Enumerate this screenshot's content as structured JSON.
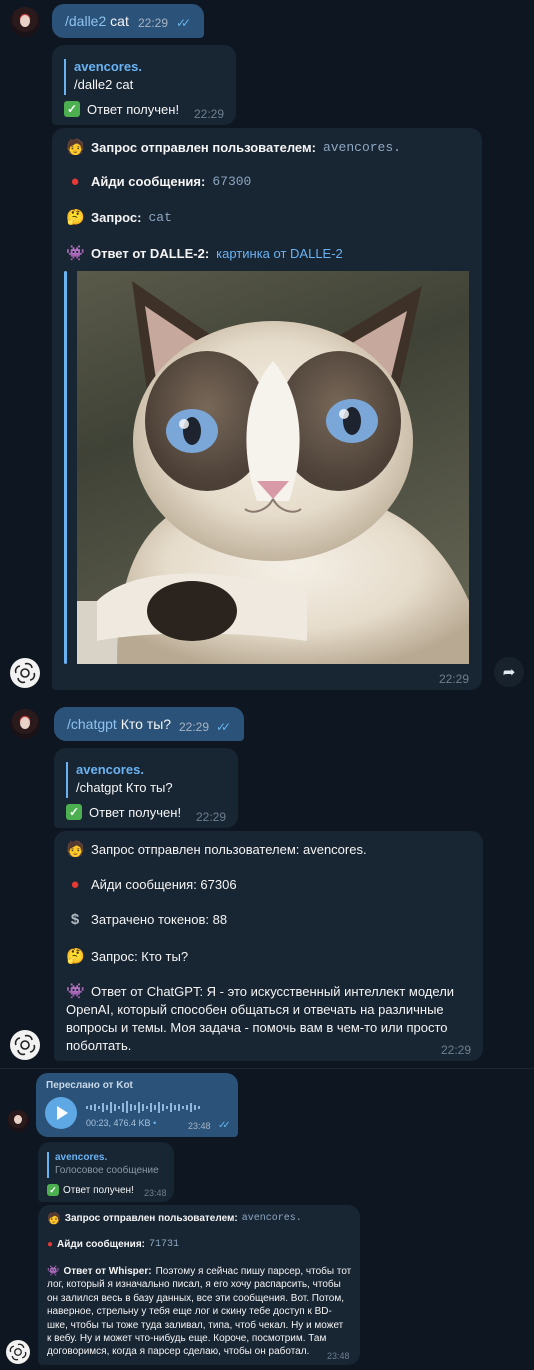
{
  "colors": {
    "bg": "#0e1621",
    "outgoing": "#2b5278",
    "incoming": "#182533",
    "accent": "#6ab3f3"
  },
  "msg1": {
    "command": "/dalle2",
    "text": "cat",
    "time": "22:29"
  },
  "reply1": {
    "name": "avencores.",
    "quote": "/dalle2 cat",
    "status": "Ответ получен!",
    "time": "22:29"
  },
  "bot1": {
    "sent_label": "Запрос отправлен пользователем:",
    "user": "avencores.",
    "id_label": "Айди сообщения:",
    "id_value": "67300",
    "query_label": "Запрос:",
    "query_value": "cat",
    "answer_label": "Ответ от DALLE-2:",
    "answer_link": "картинка от DALLE-2",
    "time": "22:29"
  },
  "msg2": {
    "command": "/chatgpt",
    "text": "Кто ты?",
    "time": "22:29"
  },
  "reply2": {
    "name": "avencores.",
    "quote": "/chatgpt Кто ты?",
    "status": "Ответ получен!",
    "time": "22:29"
  },
  "bot2": {
    "sent_line": "Запрос отправлен пользователем: avencores.",
    "id_line": "Айди сообщения: 67306",
    "tokens_line": "Затрачено токенов: 88",
    "query_line": "Запрос: Кто ты?",
    "answer_lines": [
      "Ответ от ChatGPT: Я - это искусственный интеллект модели",
      "OpenAI, который способен общаться и отвечать на различные",
      "вопросы и темы. Моя задача - помочь вам в чем-то или просто",
      "поболтать."
    ],
    "time": "22:29"
  },
  "voice": {
    "forwarded": "Переслано от Kot",
    "duration": "00:23, 476.4 KB",
    "dot": "•",
    "time": "23:48"
  },
  "reply3": {
    "name": "avencores.",
    "quote": "Голосовое сообщение",
    "status": "Ответ получен!",
    "time": "23:48"
  },
  "bot3": {
    "sent_label": "Запрос отправлен пользователем:",
    "user": "avencores.",
    "id_label": "Айди сообщения:",
    "id_value": "71731",
    "answer_label": "Ответ от Whisper:",
    "answer_lines": [
      "Поэтому я сейчас пишу парсер, чтобы тот",
      "лог, который я изначально писал, я его хочу распарсить, чтобы",
      "он залился весь в базу данных, все эти сообщения. Вот. Потом,",
      "наверное, стрельну у тебя еще лог и скину тебе доступ к BD-",
      "шке, чтобы ты тоже туда заливал, типа, чтоб чекал. Ну и может",
      "к вебу. Ну и может что-нибудь еще. Короче, посмотрим. Там",
      "договоримся, когда я парсер сделаю, чтобы он работал."
    ],
    "time": "23:48"
  },
  "icons": [
    "user-avatar",
    "chatgpt-avatar",
    "forward-icon",
    "play-icon",
    "double-check-icon",
    "check-emoji",
    "face-emoji",
    "pin-emoji",
    "thinking-emoji",
    "alien-emoji",
    "dollar-emoji"
  ]
}
